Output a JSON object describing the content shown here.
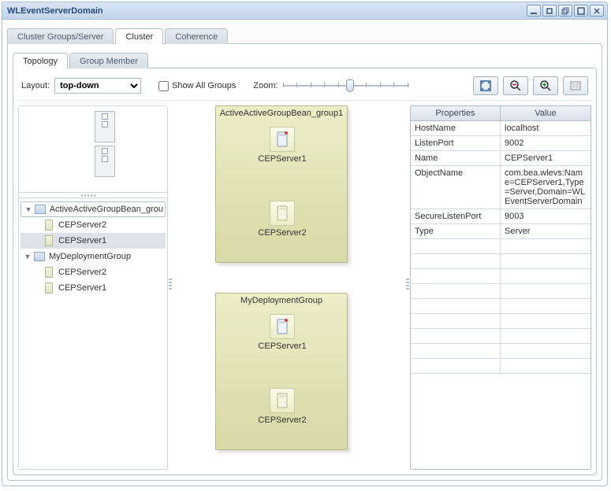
{
  "window": {
    "title": "WLEventServerDomain"
  },
  "tabs": {
    "outer": [
      {
        "label": "Cluster Groups/Server",
        "active": false
      },
      {
        "label": "Cluster",
        "active": true
      },
      {
        "label": "Coherence",
        "active": false
      }
    ],
    "inner": [
      {
        "label": "Topology",
        "active": true
      },
      {
        "label": "Group Member",
        "active": false
      }
    ]
  },
  "toolbar": {
    "layout_label": "Layout:",
    "layout_value": "top-down",
    "show_all_label": "Show All Groups",
    "show_all_checked": false,
    "zoom_label": "Zoom:",
    "buttons": {
      "fit": "fit-to-window",
      "zoom_out": "zoom-out",
      "zoom_in": "zoom-in",
      "grid": "properties-grid"
    }
  },
  "tree": {
    "groups": [
      {
        "name": "ActiveActiveGroupBean_group1",
        "display": "ActiveActiveGroupBean_grou",
        "expanded": true,
        "servers": [
          {
            "name": "CEPServer2",
            "selected": false
          },
          {
            "name": "CEPServer1",
            "selected": true
          }
        ]
      },
      {
        "name": "MyDeploymentGroup",
        "display": "MyDeploymentGroup",
        "expanded": true,
        "servers": [
          {
            "name": "CEPServer2",
            "selected": false
          },
          {
            "name": "CEPServer1",
            "selected": false
          }
        ]
      }
    ]
  },
  "diagram": {
    "groups": [
      {
        "title": "ActiveActiveGroupBean_group1",
        "servers": [
          "CEPServer1",
          "CEPServer2"
        ]
      },
      {
        "title": "MyDeploymentGroup",
        "servers": [
          "CEPServer1",
          "CEPServer2"
        ]
      }
    ]
  },
  "properties": {
    "headers": {
      "key": "Properties",
      "value": "Value"
    },
    "rows": [
      {
        "k": "HostName",
        "v": "localhost"
      },
      {
        "k": "ListenPort",
        "v": "9002"
      },
      {
        "k": "Name",
        "v": "CEPServer1"
      },
      {
        "k": "ObjectName",
        "v": "com.bea.wlevs:Name=CEPServer1,Type=Server,Domain=WLEventServerDomain"
      },
      {
        "k": "SecureListenPort",
        "v": "9003"
      },
      {
        "k": "Type",
        "v": "Server"
      }
    ],
    "empty_rows": 9
  }
}
